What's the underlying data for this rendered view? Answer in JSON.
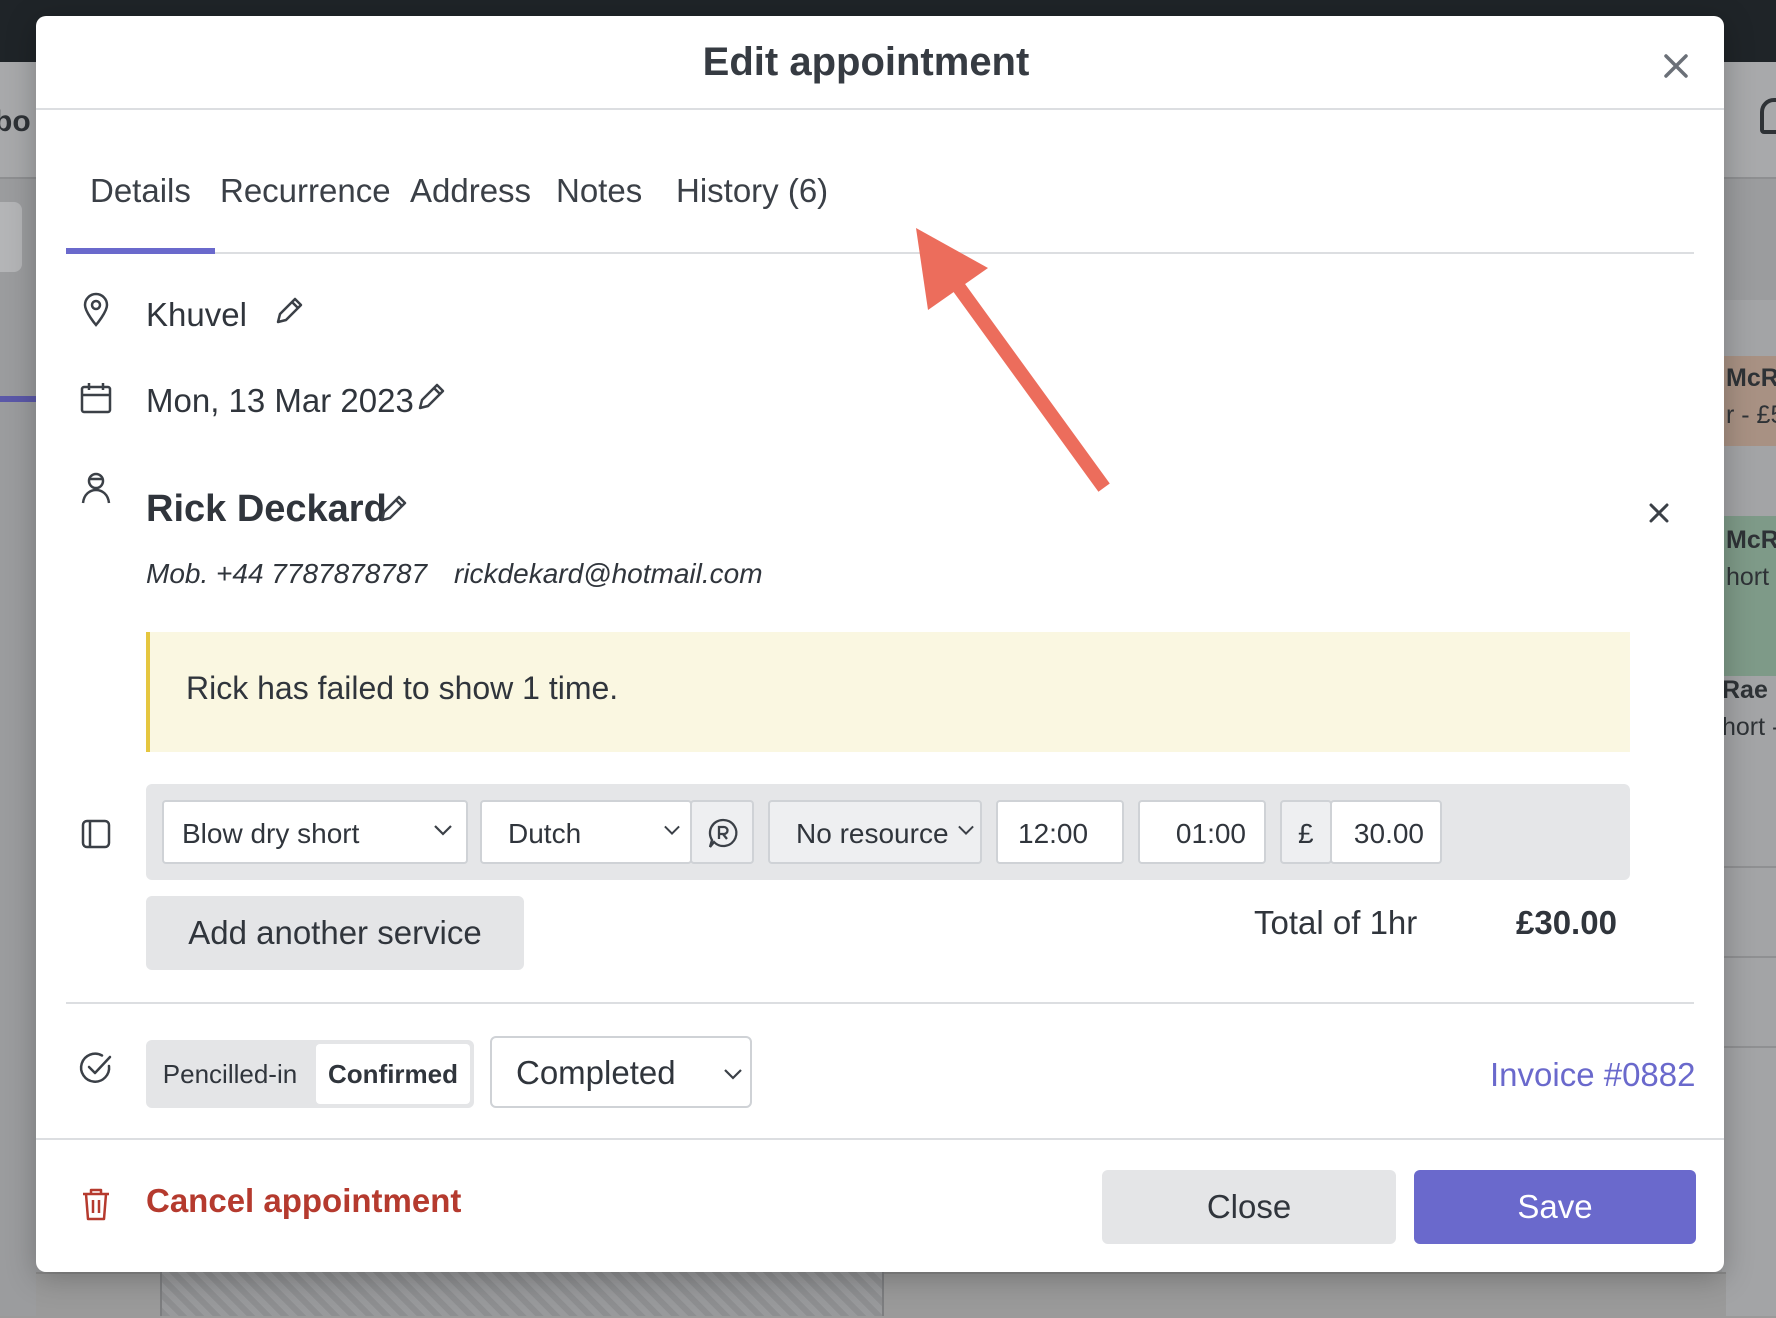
{
  "background": {
    "page_title_fragment": "bo",
    "cards": [
      {
        "name": "McR",
        "sub": "r - £5"
      },
      {
        "name": "McR",
        "sub": "hort -"
      },
      {
        "name": "Rae",
        "sub": "hort -"
      }
    ]
  },
  "modal": {
    "title": "Edit appointment",
    "tabs": [
      {
        "label": "Details",
        "active": true
      },
      {
        "label": "Recurrence",
        "active": false
      },
      {
        "label": "Address",
        "active": false
      },
      {
        "label": "Notes",
        "active": false
      },
      {
        "label": "History (6)",
        "active": false
      }
    ],
    "location": "Khuvel",
    "date": "Mon, 13 Mar 2023",
    "client": {
      "name": "Rick Deckard",
      "mobile": "Mob. +44 7787878787",
      "email": "rickdekard@hotmail.com"
    },
    "alert": "Rick has failed to show 1 time.",
    "service": {
      "service_name": "Blow dry short",
      "staff": "Dutch",
      "resource": "No resource",
      "start_time": "12:00",
      "duration": "01:00",
      "currency_symbol": "£",
      "price": "30.00"
    },
    "add_service_label": "Add another service",
    "total_label": "Total of 1hr",
    "total_value": "£30.00",
    "status": {
      "options": [
        "Pencilled-in",
        "Confirmed"
      ],
      "selected": "Confirmed",
      "outcome": "Completed"
    },
    "invoice_link": "Invoice #0882",
    "cancel_label": "Cancel appointment",
    "close_label": "Close",
    "save_label": "Save"
  },
  "colors": {
    "accent": "#6a69cc",
    "danger": "#b53a2e",
    "alert_bg": "#faf7e1",
    "alert_border": "#e5c63f",
    "annotation_arrow": "#ec6d5c"
  }
}
